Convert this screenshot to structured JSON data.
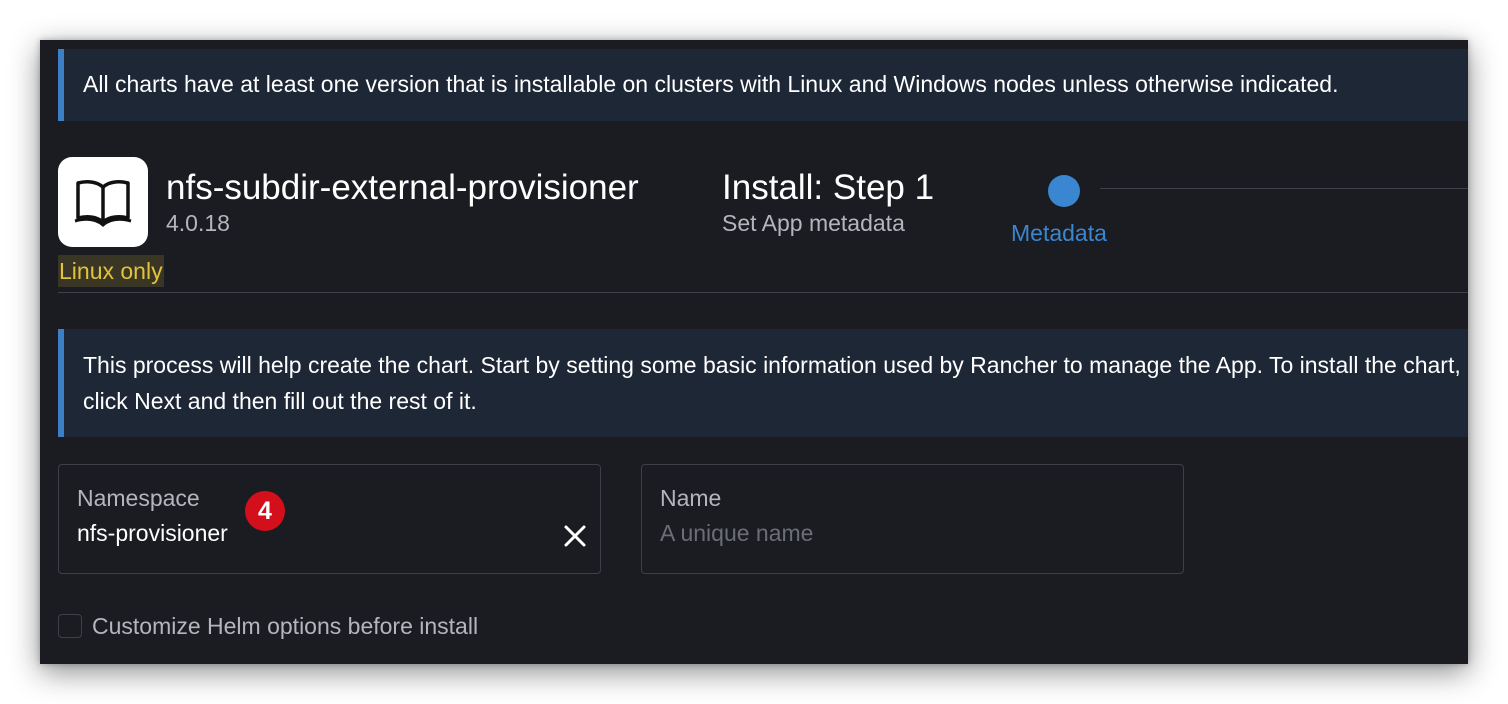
{
  "banner": {
    "text": "All charts have at least one version that is installable on clusters with Linux and Windows nodes unless otherwise indicated."
  },
  "app": {
    "icon": "open-book-icon",
    "title": "nfs-subdir-external-provisioner",
    "version": "4.0.18",
    "os_badge": "Linux only"
  },
  "install": {
    "title": "Install: Step 1",
    "subtitle": "Set App metadata",
    "steps": [
      {
        "label": "Metadata",
        "active": true
      }
    ]
  },
  "info": {
    "text": "This process will help create the chart. Start by setting some basic information used by Rancher to manage the App. To install the chart, click Next and then fill out the rest of it."
  },
  "namespace_field": {
    "label": "Namespace",
    "value": "nfs-provisioner",
    "clear_icon": "close-icon"
  },
  "name_field": {
    "label": "Name",
    "value": "",
    "placeholder": "A unique name"
  },
  "annotation": {
    "marker": "4"
  },
  "options": {
    "customize_helm_label": "Customize Helm options before install",
    "customize_helm_checked": false
  },
  "colors": {
    "background": "#1b1c21",
    "banner_background": "#1e2736",
    "accent": "#3a86d0",
    "badge_text": "#e2c33a",
    "marker": "#d20f1a"
  }
}
